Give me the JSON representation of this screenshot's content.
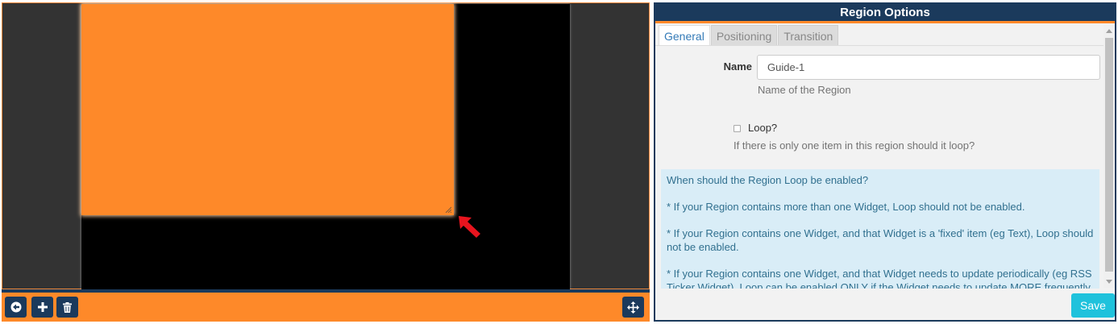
{
  "designer": {
    "region_color": "#fe8929",
    "canvas_color": "#000000",
    "toolbar": {
      "back_icon": "arrow-left-circle-icon",
      "add_icon": "plus-icon",
      "delete_icon": "trash-icon",
      "move_icon": "move-arrows-icon"
    }
  },
  "options": {
    "title": "Region Options",
    "tabs": [
      {
        "label": "General",
        "active": true
      },
      {
        "label": "Positioning",
        "active": false
      },
      {
        "label": "Transition",
        "active": false
      }
    ],
    "name_label": "Name",
    "name_value": "Guide-1",
    "name_help": "Name of the Region",
    "loop_label": "Loop?",
    "loop_checked": false,
    "loop_help": "If there is only one item in this region should it loop?",
    "info": [
      "When should the Region Loop be enabled?",
      "* If your Region contains more than one Widget, Loop should not be enabled.",
      "* If your Region contains one Widget, and that Widget is a 'fixed' item (eg Text), Loop should not be enabled.",
      "* If your Region contains one Widget, and that Widget needs to update periodically (eg RSS Ticker Widget), Loop can be enabled ONLY if the Widget needs to update MORE frequently"
    ],
    "save_label": "Save"
  },
  "colors": {
    "accent": "#fe8929",
    "navy": "#1b3a5c",
    "save": "#1fc2dc",
    "info_bg": "#d9edf7",
    "info_text": "#31708f"
  }
}
